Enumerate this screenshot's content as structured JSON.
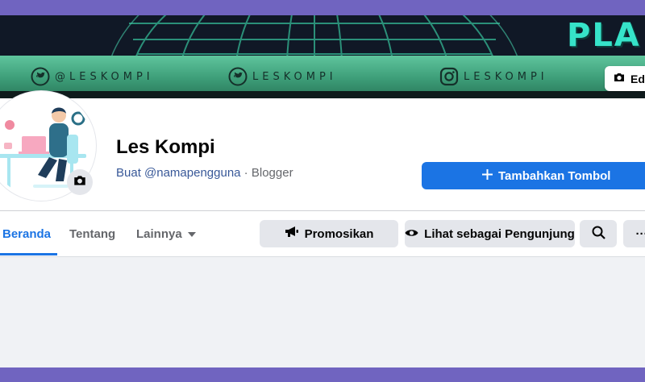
{
  "cover": {
    "title": "PLA",
    "social": [
      {
        "icon": "twitter-icon",
        "text": "@LESKOMPI"
      },
      {
        "icon": "twitter-icon",
        "text": "LESKOMPI"
      },
      {
        "icon": "instagram-icon",
        "text": "LESKOMPI"
      }
    ],
    "edit_label": "Edi"
  },
  "profile": {
    "name": "Les Kompi",
    "username_link": "Buat @namapengguna",
    "separator": " · ",
    "category": "Blogger"
  },
  "actions": {
    "add_button": "Tambahkan Tombol",
    "promote": "Promosikan",
    "view_as": "Lihat sebagai Pengunjung",
    "more": "···"
  },
  "tabs": [
    {
      "label": "Beranda",
      "active": true
    },
    {
      "label": "Tentang",
      "active": false
    },
    {
      "label": "Lainnya",
      "active": false
    }
  ],
  "colors": {
    "accent": "#1b74e4",
    "frame": "#7064c0",
    "cover_band": "#3d9d78",
    "cover_title": "#36e3c9"
  }
}
